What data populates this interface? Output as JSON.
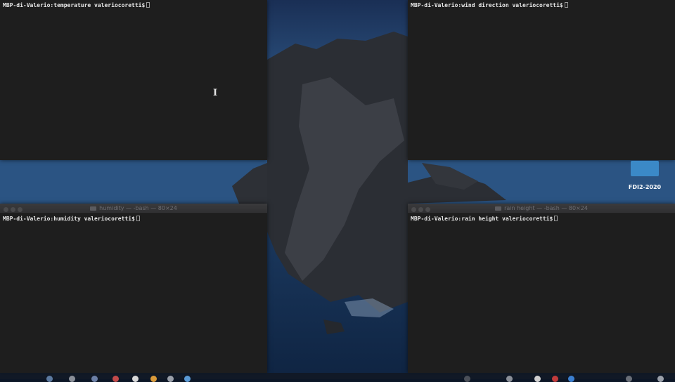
{
  "terminals": {
    "temperature": {
      "prompt": "MBP-di-Valerio:temperature valeriocoretti$"
    },
    "wind_direction": {
      "prompt": "MBP-di-Valerio:wind direction valeriocoretti$"
    },
    "humidity": {
      "title": "humidity — -bash — 80×24",
      "prompt": "MBP-di-Valerio:humidity valeriocoretti$"
    },
    "rain_height": {
      "title": "rain height — -bash — 80×24",
      "prompt": "MBP-di-Valerio:rain height valeriocoretti$"
    }
  },
  "desktop": {
    "folder_label": "FDI2-2020"
  },
  "colors": {
    "terminal_bg": "#1e1e1e",
    "folder": "#3b89c7",
    "wallpaper_sea": "#1d3a63"
  },
  "icons": [
    "i-beam-cursor-icon",
    "folder-icon",
    "traffic-light-icon"
  ]
}
